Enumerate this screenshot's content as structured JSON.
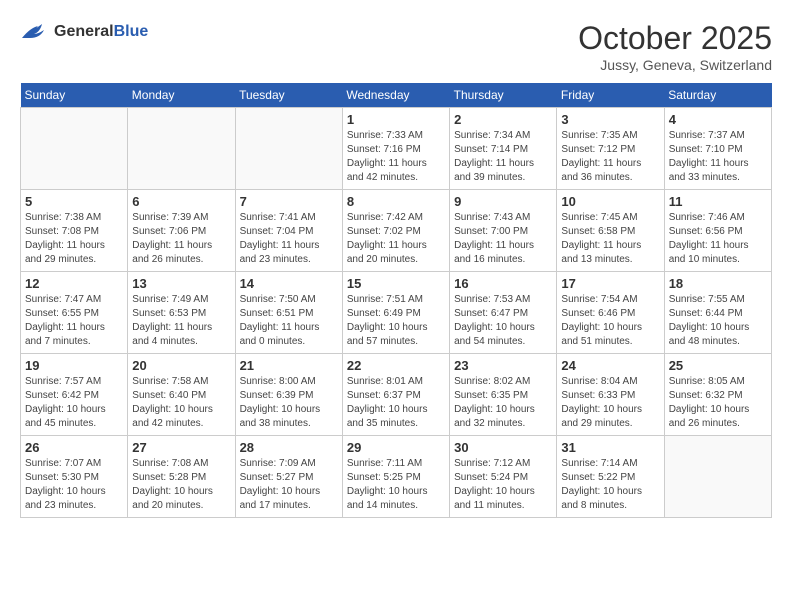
{
  "header": {
    "logo_line1": "General",
    "logo_line2": "Blue",
    "month": "October 2025",
    "location": "Jussy, Geneva, Switzerland"
  },
  "weekdays": [
    "Sunday",
    "Monday",
    "Tuesday",
    "Wednesday",
    "Thursday",
    "Friday",
    "Saturday"
  ],
  "weeks": [
    [
      {
        "day": "",
        "info": ""
      },
      {
        "day": "",
        "info": ""
      },
      {
        "day": "",
        "info": ""
      },
      {
        "day": "1",
        "info": "Sunrise: 7:33 AM\nSunset: 7:16 PM\nDaylight: 11 hours and 42 minutes."
      },
      {
        "day": "2",
        "info": "Sunrise: 7:34 AM\nSunset: 7:14 PM\nDaylight: 11 hours and 39 minutes."
      },
      {
        "day": "3",
        "info": "Sunrise: 7:35 AM\nSunset: 7:12 PM\nDaylight: 11 hours and 36 minutes."
      },
      {
        "day": "4",
        "info": "Sunrise: 7:37 AM\nSunset: 7:10 PM\nDaylight: 11 hours and 33 minutes."
      }
    ],
    [
      {
        "day": "5",
        "info": "Sunrise: 7:38 AM\nSunset: 7:08 PM\nDaylight: 11 hours and 29 minutes."
      },
      {
        "day": "6",
        "info": "Sunrise: 7:39 AM\nSunset: 7:06 PM\nDaylight: 11 hours and 26 minutes."
      },
      {
        "day": "7",
        "info": "Sunrise: 7:41 AM\nSunset: 7:04 PM\nDaylight: 11 hours and 23 minutes."
      },
      {
        "day": "8",
        "info": "Sunrise: 7:42 AM\nSunset: 7:02 PM\nDaylight: 11 hours and 20 minutes."
      },
      {
        "day": "9",
        "info": "Sunrise: 7:43 AM\nSunset: 7:00 PM\nDaylight: 11 hours and 16 minutes."
      },
      {
        "day": "10",
        "info": "Sunrise: 7:45 AM\nSunset: 6:58 PM\nDaylight: 11 hours and 13 minutes."
      },
      {
        "day": "11",
        "info": "Sunrise: 7:46 AM\nSunset: 6:56 PM\nDaylight: 11 hours and 10 minutes."
      }
    ],
    [
      {
        "day": "12",
        "info": "Sunrise: 7:47 AM\nSunset: 6:55 PM\nDaylight: 11 hours and 7 minutes."
      },
      {
        "day": "13",
        "info": "Sunrise: 7:49 AM\nSunset: 6:53 PM\nDaylight: 11 hours and 4 minutes."
      },
      {
        "day": "14",
        "info": "Sunrise: 7:50 AM\nSunset: 6:51 PM\nDaylight: 11 hours and 0 minutes."
      },
      {
        "day": "15",
        "info": "Sunrise: 7:51 AM\nSunset: 6:49 PM\nDaylight: 10 hours and 57 minutes."
      },
      {
        "day": "16",
        "info": "Sunrise: 7:53 AM\nSunset: 6:47 PM\nDaylight: 10 hours and 54 minutes."
      },
      {
        "day": "17",
        "info": "Sunrise: 7:54 AM\nSunset: 6:46 PM\nDaylight: 10 hours and 51 minutes."
      },
      {
        "day": "18",
        "info": "Sunrise: 7:55 AM\nSunset: 6:44 PM\nDaylight: 10 hours and 48 minutes."
      }
    ],
    [
      {
        "day": "19",
        "info": "Sunrise: 7:57 AM\nSunset: 6:42 PM\nDaylight: 10 hours and 45 minutes."
      },
      {
        "day": "20",
        "info": "Sunrise: 7:58 AM\nSunset: 6:40 PM\nDaylight: 10 hours and 42 minutes."
      },
      {
        "day": "21",
        "info": "Sunrise: 8:00 AM\nSunset: 6:39 PM\nDaylight: 10 hours and 38 minutes."
      },
      {
        "day": "22",
        "info": "Sunrise: 8:01 AM\nSunset: 6:37 PM\nDaylight: 10 hours and 35 minutes."
      },
      {
        "day": "23",
        "info": "Sunrise: 8:02 AM\nSunset: 6:35 PM\nDaylight: 10 hours and 32 minutes."
      },
      {
        "day": "24",
        "info": "Sunrise: 8:04 AM\nSunset: 6:33 PM\nDaylight: 10 hours and 29 minutes."
      },
      {
        "day": "25",
        "info": "Sunrise: 8:05 AM\nSunset: 6:32 PM\nDaylight: 10 hours and 26 minutes."
      }
    ],
    [
      {
        "day": "26",
        "info": "Sunrise: 7:07 AM\nSunset: 5:30 PM\nDaylight: 10 hours and 23 minutes."
      },
      {
        "day": "27",
        "info": "Sunrise: 7:08 AM\nSunset: 5:28 PM\nDaylight: 10 hours and 20 minutes."
      },
      {
        "day": "28",
        "info": "Sunrise: 7:09 AM\nSunset: 5:27 PM\nDaylight: 10 hours and 17 minutes."
      },
      {
        "day": "29",
        "info": "Sunrise: 7:11 AM\nSunset: 5:25 PM\nDaylight: 10 hours and 14 minutes."
      },
      {
        "day": "30",
        "info": "Sunrise: 7:12 AM\nSunset: 5:24 PM\nDaylight: 10 hours and 11 minutes."
      },
      {
        "day": "31",
        "info": "Sunrise: 7:14 AM\nSunset: 5:22 PM\nDaylight: 10 hours and 8 minutes."
      },
      {
        "day": "",
        "info": ""
      }
    ]
  ]
}
